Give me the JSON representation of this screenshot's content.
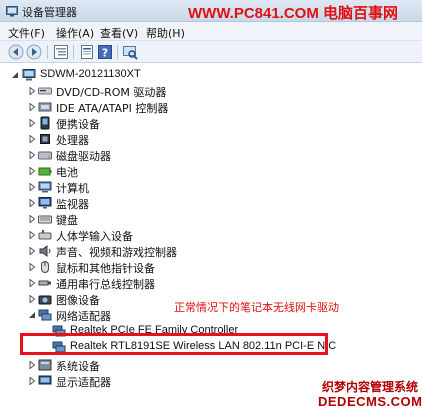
{
  "window": {
    "title": "设备管理器",
    "watermark_top": "WWW.PC841.COM 电脑百事网"
  },
  "menubar": {
    "items": [
      "文件(F)",
      "操作(A)",
      "查看(V)",
      "帮助(H)"
    ]
  },
  "toolbar": {
    "buttons": [
      "back-icon",
      "forward-icon",
      "tree-view-icon",
      "properties-icon",
      "help-icon",
      "scan-hardware-icon"
    ]
  },
  "tree": {
    "root": "SDWM-20121130XT",
    "items": [
      {
        "label": "DVD/CD-ROM 驱动器",
        "icon": "dvd-drive-icon",
        "expanded": false
      },
      {
        "label": "IDE ATA/ATAPI 控制器",
        "icon": "ide-controller-icon",
        "expanded": false
      },
      {
        "label": "便携设备",
        "icon": "portable-device-icon",
        "expanded": false
      },
      {
        "label": "处理器",
        "icon": "processor-icon",
        "expanded": false
      },
      {
        "label": "磁盘驱动器",
        "icon": "disk-drive-icon",
        "expanded": false
      },
      {
        "label": "电池",
        "icon": "battery-icon",
        "expanded": false
      },
      {
        "label": "计算机",
        "icon": "computer-icon",
        "expanded": false
      },
      {
        "label": "监视器",
        "icon": "monitor-icon",
        "expanded": false
      },
      {
        "label": "键盘",
        "icon": "keyboard-icon",
        "expanded": false
      },
      {
        "label": "人体学输入设备",
        "icon": "hid-icon",
        "expanded": false
      },
      {
        "label": "声音、视频和游戏控制器",
        "icon": "sound-icon",
        "expanded": false
      },
      {
        "label": "鼠标和其他指针设备",
        "icon": "mouse-icon",
        "expanded": false
      },
      {
        "label": "通用串行总线控制器",
        "icon": "usb-icon",
        "expanded": false
      },
      {
        "label": "图像设备",
        "icon": "imaging-device-icon",
        "expanded": false
      },
      {
        "label": "网络适配器",
        "icon": "network-adapter-icon",
        "expanded": true,
        "children": [
          {
            "label": "Realtek PCIe FE Family Controller",
            "icon": "network-card-icon"
          },
          {
            "label": "Realtek RTL8191SE Wireless LAN 802.11n PCI-E NIC",
            "icon": "network-card-icon"
          }
        ]
      },
      {
        "label": "系统设备",
        "icon": "system-device-icon",
        "expanded": false
      },
      {
        "label": "显示适配器",
        "icon": "display-adapter-icon",
        "expanded": false
      }
    ]
  },
  "annotation": "正常情况下的笔记本无线网卡驱动",
  "watermark_bottom": {
    "line1": "织梦内容管理系统",
    "line2": "DEDECMS.COM"
  },
  "colors": {
    "annotation_red": "#e01010",
    "highlight_box": "#e8111b",
    "titlebar": "#dfe8f3"
  }
}
